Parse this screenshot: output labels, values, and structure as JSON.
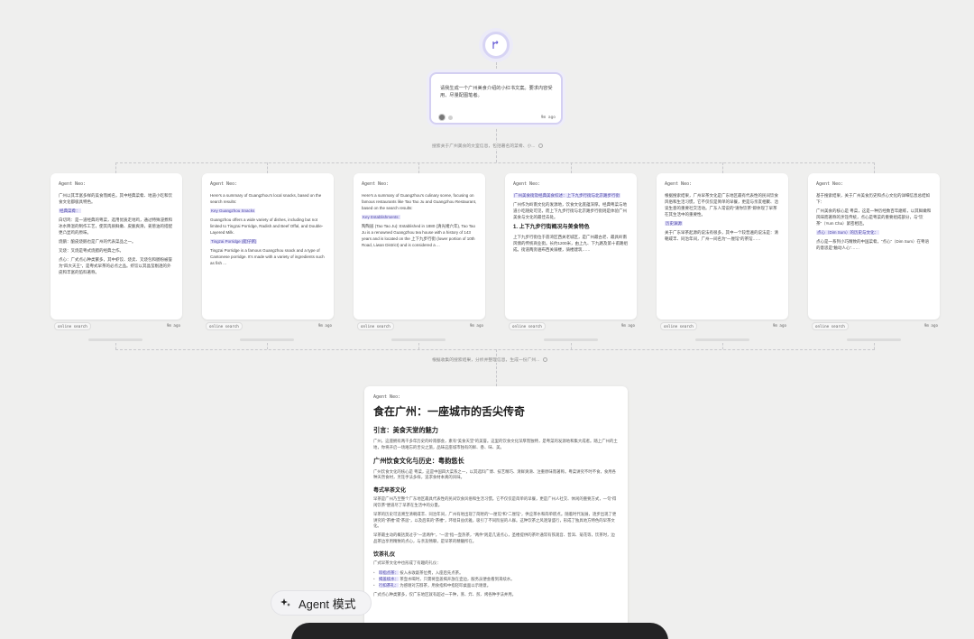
{
  "prompt": {
    "text": "请我生成一个广州美食介绍的小红书文案。要求内容受用、尽量配图笔者。",
    "time": "9m ago"
  },
  "steps": {
    "search_label": "搜索关于广州美食的文室信息，包括著名的菜肴、小...",
    "compose_label": "根据收集的搜索结果，分析并整理信息，生成一份广州..."
  },
  "cards": [
    {
      "agent": "Agent Neo:",
      "lines": [
        "广州以其丰富多样的美食而闻名，其中经典菜肴、地道小吃和饮食文化都极具特色。",
        "经典菜肴：",
        "白切鸡：是一道经典的粤菜，选用优质走地鸡，通过特殊浸煮和冰水降温的制作工艺，使其肉质鲜嫩、皮脆爽滑，姜葱油的搭配更凸显鸡的原味。",
        "烧鹅：酿皮烧鹅也是广州的代表菜品之一。",
        "叉烧：叉烧是粤式烧腊的经典之作。",
        "点心：广式点心种类繁多，其中虾饺、烧卖、叉烧包和肠粉被誉为“四大天王”，是粤式早茶的必点之品。虾饺以其晶莹剔透的外皮和丰富的馅料著称。"
      ],
      "tag": "online search",
      "time": "9m ago"
    },
    {
      "agent": "Agent Neo:",
      "lines": [
        "Here's a summary of Guangzhou's local snacks, based on the search results:",
        "Key Guangzhou Snacks",
        "Guangzhou offers a wide variety of dishes, including but not limited to Tingzai Porridge, Radish and Beef Offal, and Double-Layered Milk.",
        "Tingzai Porridge (艇仔粥)",
        "Tingzai Porridge is a famous Guangzhou snack and a type of Cantonese porridge. It's made with a variety of ingredients such as fish ..."
      ],
      "tag": "online search",
      "time": "9m ago"
    },
    {
      "agent": "Agent Neo:",
      "lines": [
        "Here's a summary of Guangzhou's culinary scene, focusing on famous restaurants like Tao Tao Ju and Guangzhou Restaurant, based on the search results:",
        "Key Establishments:",
        "陶陶居 (Tao Tao Ju): Established in 1880 (清光绪六年), Tao Tao Ju is a renowned Guangzhou tea house with a history of 143 years and is located on the 上下九步行街 (lower portion of 10th Road, Liwan District) and is considered a ..."
      ],
      "tag": "online search",
      "time": "9m ago"
    },
    {
      "agent": "Agent Neo:",
      "lines": [
        "广州美食街及经典美食综述：上下九步行街与北京路步行街",
        "广州作为岭南文化的发源地，饮食文化底蕴深厚。经典粤菜与地道小吃随处可见，而上下九步行街与北京路步行街则是体验广州美食与文化的最佳去处。",
        "1. 上下九步行街概况与美食特色",
        "上下九步行街位于荔湾区西关老城区，是广州最古老、最具岭南风情的传统商业街。长约1200米，由上九、下九路及第十甫路组成。街道两旁遍布西关骑楼，骑楼建筑……"
      ],
      "tag": "online search",
      "time": "9m ago"
    },
    {
      "agent": "Agent Neo:",
      "lines": [
        "根据搜索结果，广州早茶文化是广东地区最有代表性的民间饮食风俗和生活习惯，它不仅仅是简单的早餐，更是与亲友相聚、洽谈生意的重要社交活动。广东人常说的“请你饮茶”即体现了早茶在其生活中的重要性。",
        "历史渊源",
        "关于广东早茶起源的说法有很多，其中一个较普遍的说法是：清朝咸丰、同治年间，广州一间名为“一厘馆”的茶馆……"
      ],
      "tag": "online search",
      "time": "9m ago"
    },
    {
      "agent": "Agent Neo:",
      "lines": [
        "基于搜索结果，关于广州美食历史和点心文化的详细信息总结如下：",
        "广州美食的核心是 粤菜，这是一种历经数百年磨练，以其鲜嫩和风味而著称的烹饪传统，点心是粤菜的重要组成部分，与“饮茶”（Yum Cha）紧密相连。",
        "点心（Dim Sum）的历史与文化：",
        "点心是一系列小巧精致的中国菜肴，“点心”（Dim Sum）在粤语的意思是“触动人心”……"
      ],
      "tag": "online search",
      "time": "9m ago"
    }
  ],
  "doc": {
    "agent": "Agent Neo:",
    "title": "食在广州：一座城市的舌尖传奇",
    "sections": [
      {
        "h": "引言：美食天堂的魅力",
        "level": 2,
        "p": "广州，这座拥有两千多年历史的岭南都会，素有“美食天堂”的美誉。这里的饮食文化深厚而独特，是粤菜的发源地和集大成者。踏上广州的土地，你将开启一场难忘的舌尖之旅，品味这座城市独有的鲜、香、味、美。"
      },
      {
        "h": "广州饮食文化与历史：粤韵悠长",
        "level": 2,
        "p": "广州饮食文化的核心是 粤菜，这是中国四大菜系之一，以其选料广博、技艺精巧、清鲜爽滑、注重原味而著称。粤菜讲究不时不食，食用各种天然食材，烹饪手法多样，追求食材本真的风味。"
      },
      {
        "h": "粤式早茶文化",
        "level": 3,
        "p": "早茶是广州乃至整个广东地区最具代表性的民间饮食风俗和生活习惯。它不仅仅是简单的早餐，更是广州人社交、休闲的重要方式，一句“得闲饮茶”便道尽了早茶在生活中的分量。"
      },
      {
        "h": "",
        "level": 0,
        "p": "早茶的历史可追溯至清朝咸丰、同治年间，广州有地出现了简陋的“一厘馆”和“二厘馆”，供应茶水和简单糕点。随着时代发展，逐步出现了更讲究的“茶楼”或“茶居”，以及后来的“茶楼”，环境日益优雅，吸引了不同阶层的人群。这种饮茶之风逐渐盛行，形成了独具地方特色的早茶文化。"
      },
      {
        "h": "",
        "level": 0,
        "p": "早茶最主动的概括莫过于“一盅两件”，“一盅”指一壶热茶，“两件”则是几道点心，圣楼提供的茶叶通常有铁观音、普洱、菊花等，饮茶时，边品茶边享用精致的点心，与亲友畅聊，是早茶的精髓所在。"
      },
      {
        "h": "饮茶礼仪",
        "level": 3,
        "p": "广式早茶文化中也形成了有趣的礼仪："
      }
    ],
    "bullets": [
      {
        "k": "叩指点茶：",
        "v": "按入永收敲茶位费，入座后先点茶。"
      },
      {
        "k": "揭盖续水：",
        "v": "茶壶水喝时，只需将壶盖揭开放在壶边，服务员便会看到来续水。"
      },
      {
        "k": "行扣茶礼：",
        "v": "为感谢对方斟茶，用食指和中指轻叩桌面以示谢意。"
      }
    ],
    "tail": "广式点心种类繁多，仅广东地区就有超过一千种，蒸、炸、煎、烤各种手法并用。"
  },
  "agent_mode": {
    "label": "Agent 模式"
  }
}
